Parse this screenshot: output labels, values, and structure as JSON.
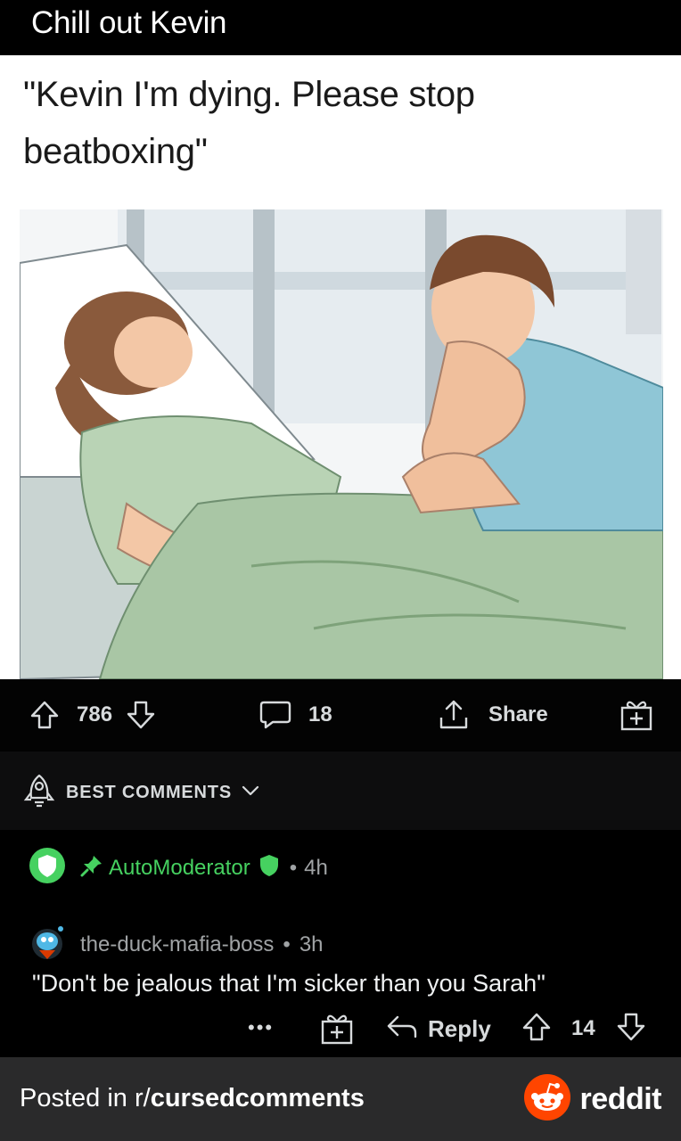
{
  "post": {
    "title": "Chill out Kevin",
    "caption_line1": "\"Kevin I'm dying. Please stop",
    "caption_line2": "beatboxing\""
  },
  "actions": {
    "upvotes": "786",
    "comments": "18",
    "share_label": "Share"
  },
  "sort": {
    "label": "BEST COMMENTS"
  },
  "automod": {
    "username": "AutoModerator",
    "dot": "•",
    "age": "4h"
  },
  "comment": {
    "username": "the-duck-mafia-boss",
    "dot": "•",
    "age": "3h",
    "body": "\"Don't be jealous that I'm sicker than you Sarah\"",
    "more": "•••",
    "reply_label": "Reply",
    "votes": "14"
  },
  "footer": {
    "posted_prefix": "Posted in r/",
    "subreddit": "cursedcomments",
    "brand": "reddit"
  },
  "colors": {
    "background": "#000000",
    "mod_green": "#46d160",
    "reddit_orange": "#ff4500",
    "footer_bg": "#2a2a2b"
  },
  "icons": [
    "upvote-icon",
    "downvote-icon",
    "comment-icon",
    "share-icon",
    "award-icon",
    "rocket-icon",
    "chevron-down-icon",
    "shield-icon",
    "pin-icon",
    "avatar",
    "reply-icon",
    "more-icon",
    "reddit-logo"
  ]
}
